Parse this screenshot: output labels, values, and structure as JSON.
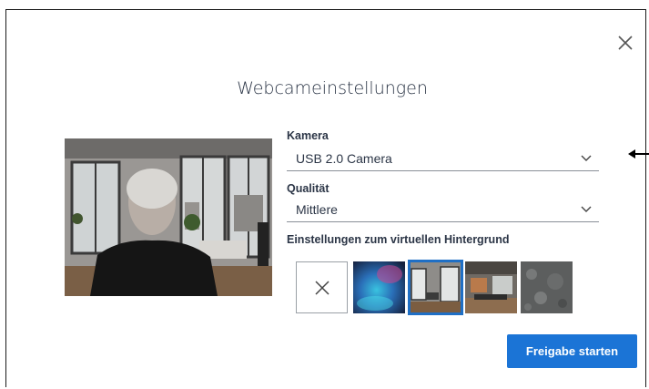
{
  "dialog": {
    "title": "Webcameinstellungen",
    "close_icon": "close-icon"
  },
  "camera": {
    "label": "Kamera",
    "value": "USB 2.0 Camera"
  },
  "quality": {
    "label": "Qualität",
    "value": "Mittlere"
  },
  "virtual_background": {
    "label": "Einstellungen zum virtuellen Hintergrund",
    "options": [
      "none",
      "blue-abstract",
      "living-room",
      "office",
      "concrete-texture"
    ],
    "selected_index": 2
  },
  "actions": {
    "start_label": "Freigabe starten"
  },
  "colors": {
    "primary": "#1b74d6",
    "selected_outline": "#1f6fc5",
    "text": "#2b3546"
  }
}
